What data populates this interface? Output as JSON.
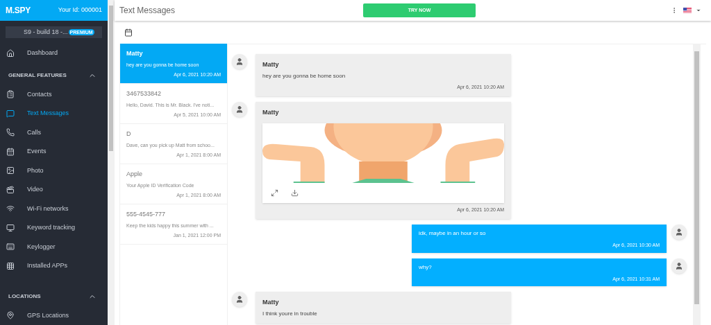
{
  "sidebar": {
    "logo": "M.SPY",
    "user_id": "Your Id: 000001",
    "device": {
      "name": "S9 - build 18 -...",
      "badge": "PREMIUM"
    },
    "items": [
      {
        "kind": "link",
        "label": "Dashboard",
        "selected": false
      },
      {
        "kind": "section",
        "label": "GENERAL FEATURES",
        "expanded": true
      },
      {
        "kind": "link",
        "label": "Contacts",
        "selected": false
      },
      {
        "kind": "link",
        "label": "Text Messages",
        "selected": true
      },
      {
        "kind": "link",
        "label": "Calls",
        "selected": false
      },
      {
        "kind": "link",
        "label": "Events",
        "selected": false
      },
      {
        "kind": "link",
        "label": "Photo",
        "selected": false
      },
      {
        "kind": "link",
        "label": "Video",
        "selected": false
      },
      {
        "kind": "link",
        "label": "Wi-Fi networks",
        "selected": false
      },
      {
        "kind": "link",
        "label": "Keyword tracking",
        "selected": false
      },
      {
        "kind": "link",
        "label": "Keylogger",
        "selected": false
      },
      {
        "kind": "link",
        "label": "Installed APPs",
        "selected": false
      },
      {
        "kind": "section",
        "label": "LOCATIONS",
        "expanded": true
      },
      {
        "kind": "link",
        "label": "GPS Locations",
        "selected": false
      }
    ]
  },
  "header": {
    "title": "Text Messages",
    "cta": "TRY NOW"
  },
  "conversations": [
    {
      "name": "Matty",
      "preview": "hey are you gonna be home soon",
      "time": "Apr 6, 2021 10:20 AM",
      "selected": true
    },
    {
      "name": "3467533842",
      "preview": "Hello, David. This is Mr. Black. I've noti...",
      "time": "Apr 5, 2021 10:00 AM",
      "selected": false
    },
    {
      "name": "D",
      "preview": "Dave, can you pick up Matt from schoo...",
      "time": "Apr 1, 2021 8:00 AM",
      "selected": false
    },
    {
      "name": "Apple",
      "preview": "Your Apple ID Verification Code",
      "time": "Apr 1, 2021 8:00 AM",
      "selected": false
    },
    {
      "name": "555-4545-777",
      "preview": "Keep the kids happy this summer with ...",
      "time": "Jan 1, 2021 12:00 PM",
      "selected": false
    }
  ],
  "messages": [
    {
      "kind": "incoming",
      "sender": "Matty",
      "text": "hey are you gonna be home soon",
      "time": "Apr 6, 2021 10:20 AM"
    },
    {
      "kind": "incoming",
      "sender": "Matty",
      "time": "Apr 6, 2021 10:20 AM"
    },
    {
      "kind": "outgoing",
      "text": "idk, maybe in an hour or so",
      "time": "Apr 6, 2021 10:30 AM"
    },
    {
      "kind": "outgoing",
      "text": "why?",
      "time": "Apr 6, 2021 10:31 AM"
    },
    {
      "kind": "incoming",
      "sender": "Matty",
      "text": "I think youre in trouble"
    }
  ]
}
